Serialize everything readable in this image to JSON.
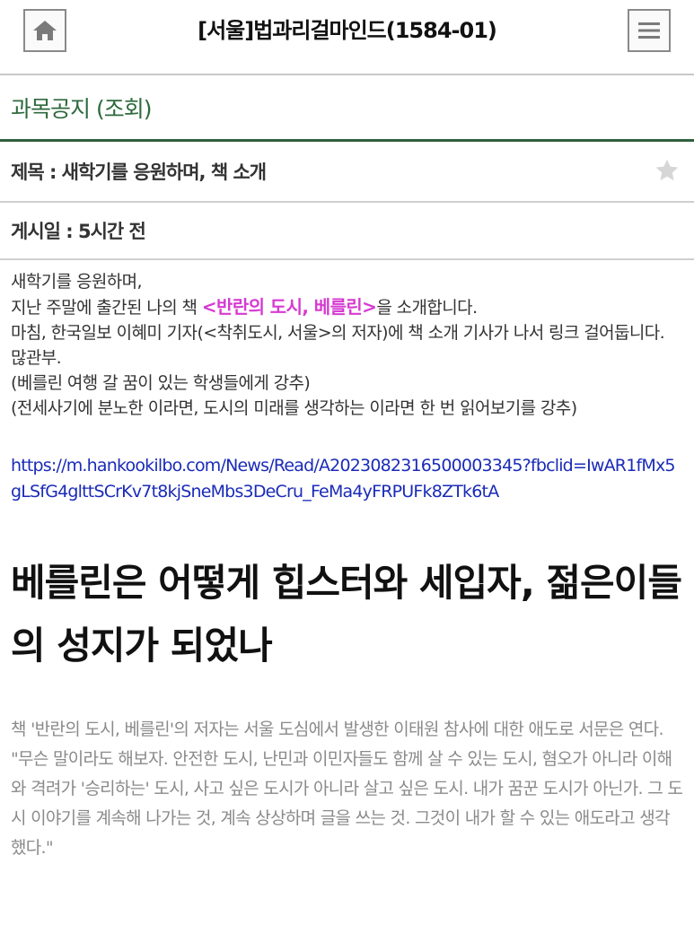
{
  "header": {
    "title": "[서울]법과리걸마인드(1584-01)",
    "home_icon": "home-icon",
    "menu_icon": "hamburger-menu-icon"
  },
  "section": {
    "title": "과목공지 (조회)"
  },
  "post": {
    "subject": "제목 : 새학기를 응원하며, 책 소개",
    "posted": "게시일 : 5시간 전",
    "favorite_icon": "star-icon"
  },
  "content": {
    "line1": "새학기를 응원하며,",
    "line2_before": "지난 주말에 출간된 나의 책 ",
    "line2_book": "<반란의 도시, 베를린>",
    "line2_after": "을 소개합니다.",
    "line3": "마침, 한국일보 이혜미 기자(<착취도시, 서울>의 저자)에 책 소개 기사가 나서 링크 걸어둡니다. 많관부.",
    "line4": "(베를린 여행 갈 꿈이 있는 학생들에게 강추)",
    "line5": "(전세사기에 분노한 이라면, 도시의 미래를 생각하는 이라면 한 번 읽어보기를 강추)",
    "link": "https://m.hankookilbo.com/News/Read/A2023082316500003345?fbclid=IwAR1fMx5gLSfG4glttSCrKv7t8kjSneMbs3DeCru_FeMa4yFRPUFk8ZTk6tA"
  },
  "article": {
    "headline": "베를린은 어떻게 힙스터와 세입자, 젊은이들의 성지가 되었나",
    "summary": "책 '반란의 도시, 베를린'의 저자는 서울 도심에서 발생한 이태원 참사에 대한 애도로 서문은 연다. \"무슨 말이라도 해보자. 안전한 도시, 난민과 이민자들도 함께 살 수 있는 도시, 혐오가 아니라 이해와 격려가 '승리하는' 도시, 사고 싶은 도시가 아니라 살고 싶은 도시. 내가 꿈꾼 도시가 아닌가. 그 도시 이야기를 계속해 나가는 것, 계속 상상하며 글을 쓰는 것. 그것이 내가 할 수 있는 애도라고 생각했다.\""
  },
  "colors": {
    "accent_green": "#2e6a3d",
    "book_title_pink": "#d63ad2",
    "link_blue": "#1a2bb8"
  }
}
